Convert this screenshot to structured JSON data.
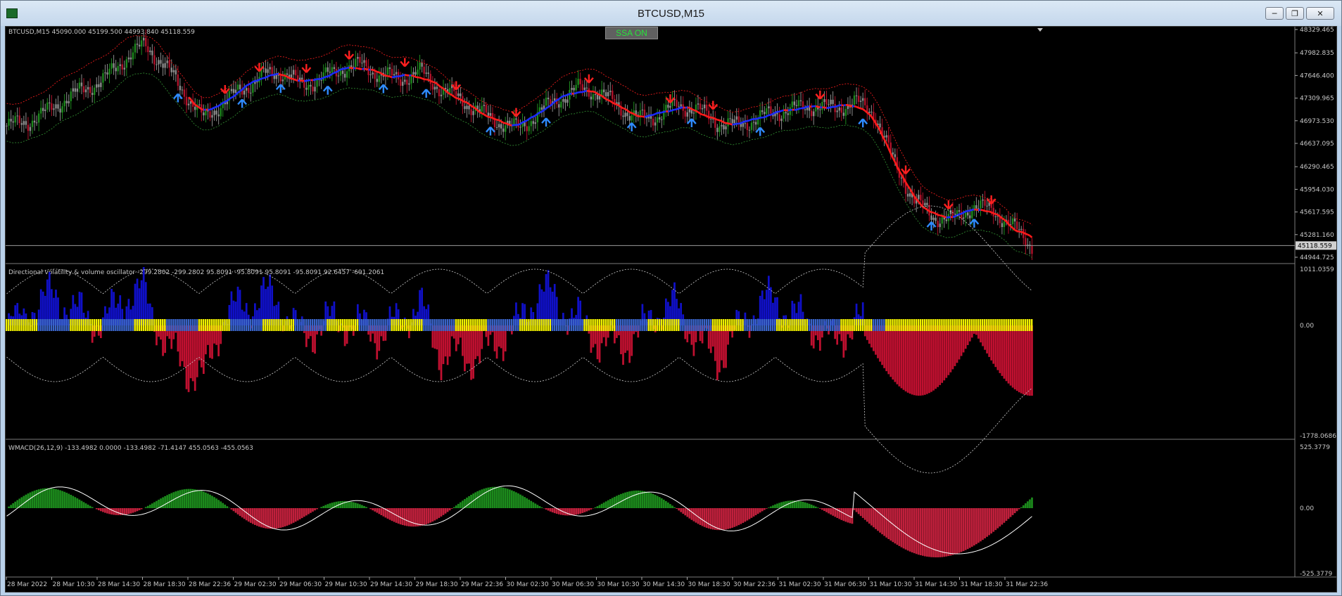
{
  "window": {
    "title": "BTCUSD,M15"
  },
  "ssa_button": "SSA ON",
  "price_panel": {
    "label": "BTCUSD,M15  45090.000 45199.500 44993.840 45118.559",
    "axis_ticks": [
      "48329.465",
      "47982.835",
      "47646.400",
      "47309.965",
      "46973.530",
      "46637.095",
      "46290.465",
      "45954.030",
      "45617.595",
      "45281.160",
      "44944.725"
    ],
    "current_price": "45118.559"
  },
  "osc_panel": {
    "label": "Directional volatility & volume oscillator -299.2802 -299.2802 95.8091 -95.8091 95.8091 -95.8091 92.6457 -691.2061",
    "axis_ticks": [
      "1011.0359",
      "0.00",
      "-1778.0686"
    ]
  },
  "macd_panel": {
    "label": "WMACD(26,12,9) -133.4982 0.0000 -133.4982 -71.4147 455.0563 -455.0563",
    "axis_ticks": [
      "525.3779",
      "0.00",
      "-525.3779"
    ]
  },
  "time_axis": [
    "28 Mar 2022",
    "28 Mar 10:30",
    "28 Mar 14:30",
    "28 Mar 18:30",
    "28 Mar 22:36",
    "29 Mar 02:30",
    "29 Mar 06:30",
    "29 Mar 10:30",
    "29 Mar 14:30",
    "29 Mar 18:30",
    "29 Mar 22:36",
    "30 Mar 02:30",
    "30 Mar 06:30",
    "30 Mar 10:30",
    "30 Mar 14:30",
    "30 Mar 18:30",
    "30 Mar 22:36",
    "31 Mar 02:30",
    "31 Mar 06:30",
    "31 Mar 10:30",
    "31 Mar 14:30",
    "31 Mar 18:30",
    "31 Mar 22:36"
  ],
  "colors": {
    "bull_candle": "#1e8a1e",
    "bear_candle": "#b0122a",
    "neutral_candle": "#8c8c8c",
    "ssa_up": "#1a2bff",
    "ssa_down": "#ff1a1a",
    "arrow_up": "#2f8bff",
    "arrow_down": "#ff2020",
    "osc_blue": "#1010c8",
    "osc_red": "#c01030",
    "osc_yellow": "#f0f000",
    "macd_green": "#1c8a1c",
    "macd_red": "#c0203c"
  },
  "chart_data": {
    "type": "line",
    "series": [
      {
        "name": "BTCUSD,M15",
        "close_profile": [
          46900,
          46950,
          47100,
          47300,
          47450,
          47600,
          47900,
          48100,
          47800,
          47400,
          47000,
          47250,
          47450,
          47650,
          47700,
          47500,
          47600,
          47750,
          47800,
          47650,
          47600,
          47700,
          47450,
          47300,
          47100,
          46950,
          46850,
          47100,
          47300,
          47450,
          47400,
          47200,
          47000,
          47050,
          47200,
          47150,
          46950,
          46900,
          47000,
          47100,
          47150,
          47200,
          47150,
          47250,
          47100,
          46350,
          45800,
          45550,
          45500,
          45700,
          45650,
          45400,
          45118.559
        ]
      }
    ]
  }
}
